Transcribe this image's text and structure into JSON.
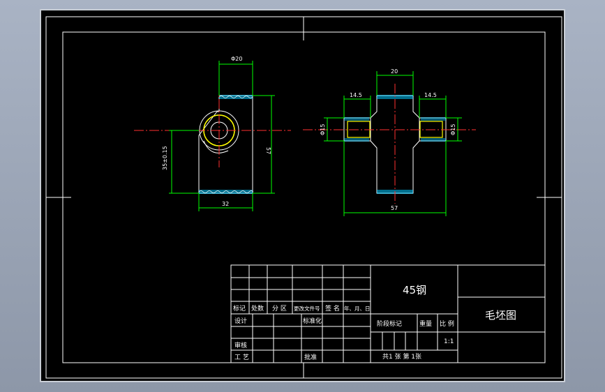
{
  "drawing": {
    "side_view": {
      "dim_top": "Φ20",
      "dim_right": "57",
      "dim_left": "35±0.15",
      "dim_bottom": "32"
    },
    "front_view": {
      "dim_top": "20",
      "dim_top_left": "14.5",
      "dim_top_right": "14.5",
      "dim_left": "Φ15",
      "dim_right": "Φ15",
      "dim_bottom": "57"
    }
  },
  "title_block": {
    "material": "45钢",
    "drawing_name": "毛坯图",
    "headers": {
      "mark": "标记",
      "count": "处数",
      "zone": "分 区",
      "change_doc": "更改文件号",
      "sign": "签 名",
      "date": "年、月、日"
    },
    "design": "设计",
    "standardize": "标准化",
    "review": "审核",
    "process": "工 艺",
    "approve": "批准",
    "stage_mark": "阶段标记",
    "weight": "重量",
    "scale_label": "比 例",
    "scale_value": "1:1",
    "sheets": "共1  张   第  1张"
  }
}
